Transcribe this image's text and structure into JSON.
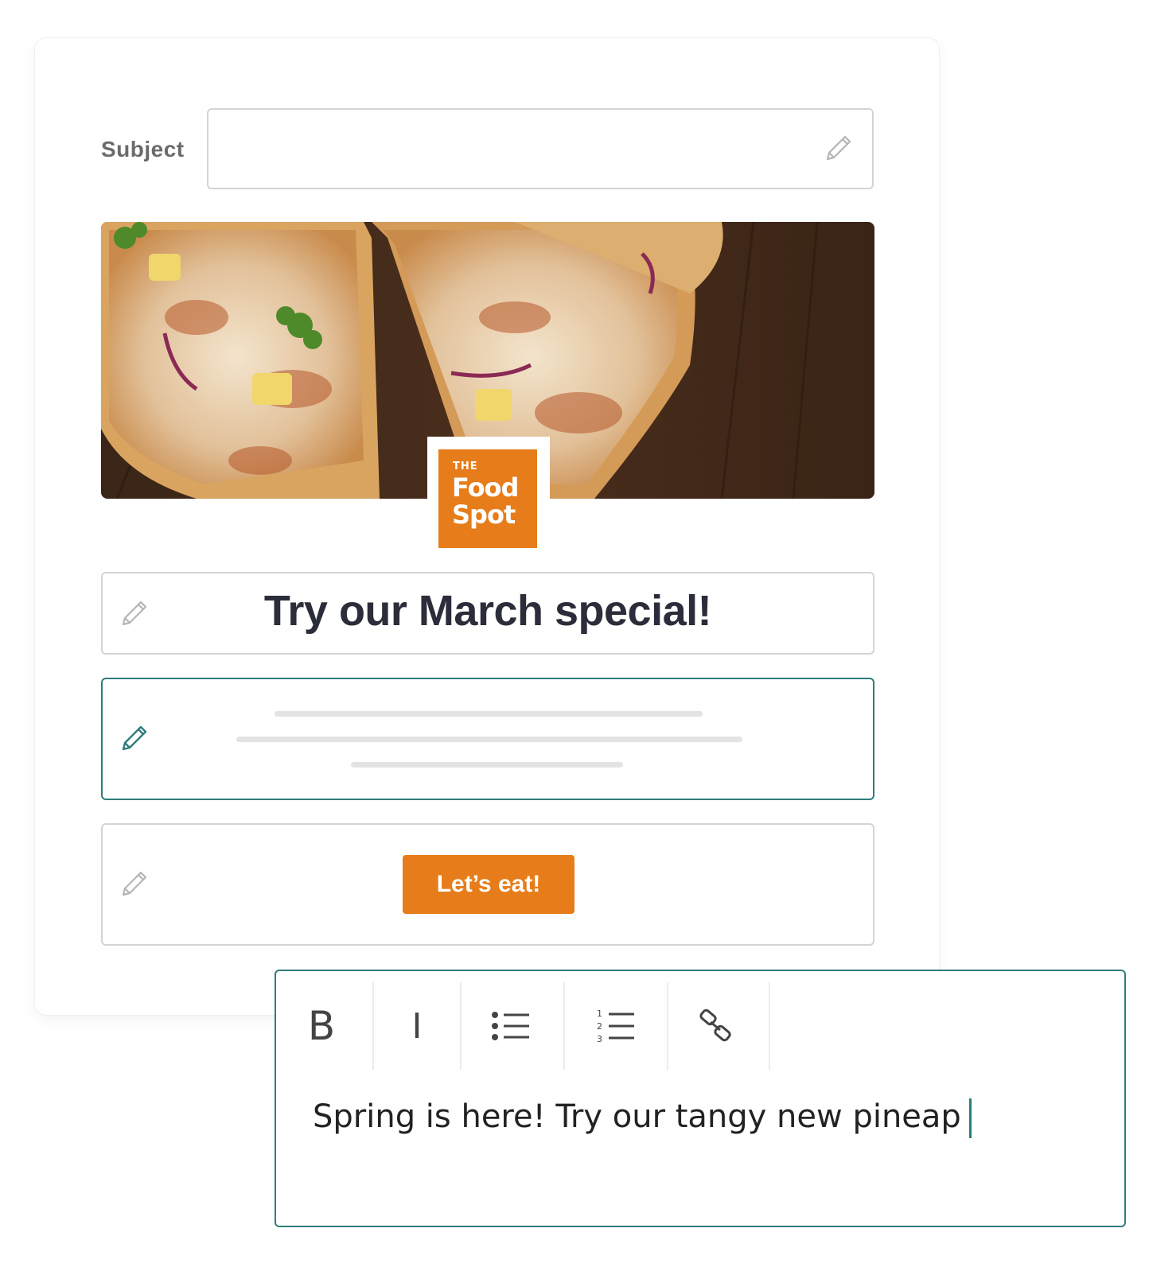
{
  "subject": {
    "label": "Subject",
    "value": "",
    "icon": "pencil-icon"
  },
  "hero": {
    "image": "pizza-slices-photo",
    "logo": {
      "line1": "THE",
      "line2": "Food",
      "line3": "Spot",
      "color": "#e67d1a"
    }
  },
  "headline_block": {
    "text": "Try our March special!",
    "icon": "pencil-icon"
  },
  "body_block": {
    "state": "active",
    "icon": "pencil-icon"
  },
  "button_block": {
    "cta_label": "Let’s eat!",
    "cta_color": "#e67d1a",
    "icon": "pencil-icon"
  },
  "editor": {
    "toolbar": {
      "bold_label": "B",
      "italic_label": "I",
      "bullet_list_icon": "bullet-list-icon",
      "numbered_list_icon": "numbered-list-icon",
      "link_icon": "link-icon"
    },
    "text": "Spring is here! Try our tangy new pineap",
    "accent": "#2e7d7b"
  }
}
